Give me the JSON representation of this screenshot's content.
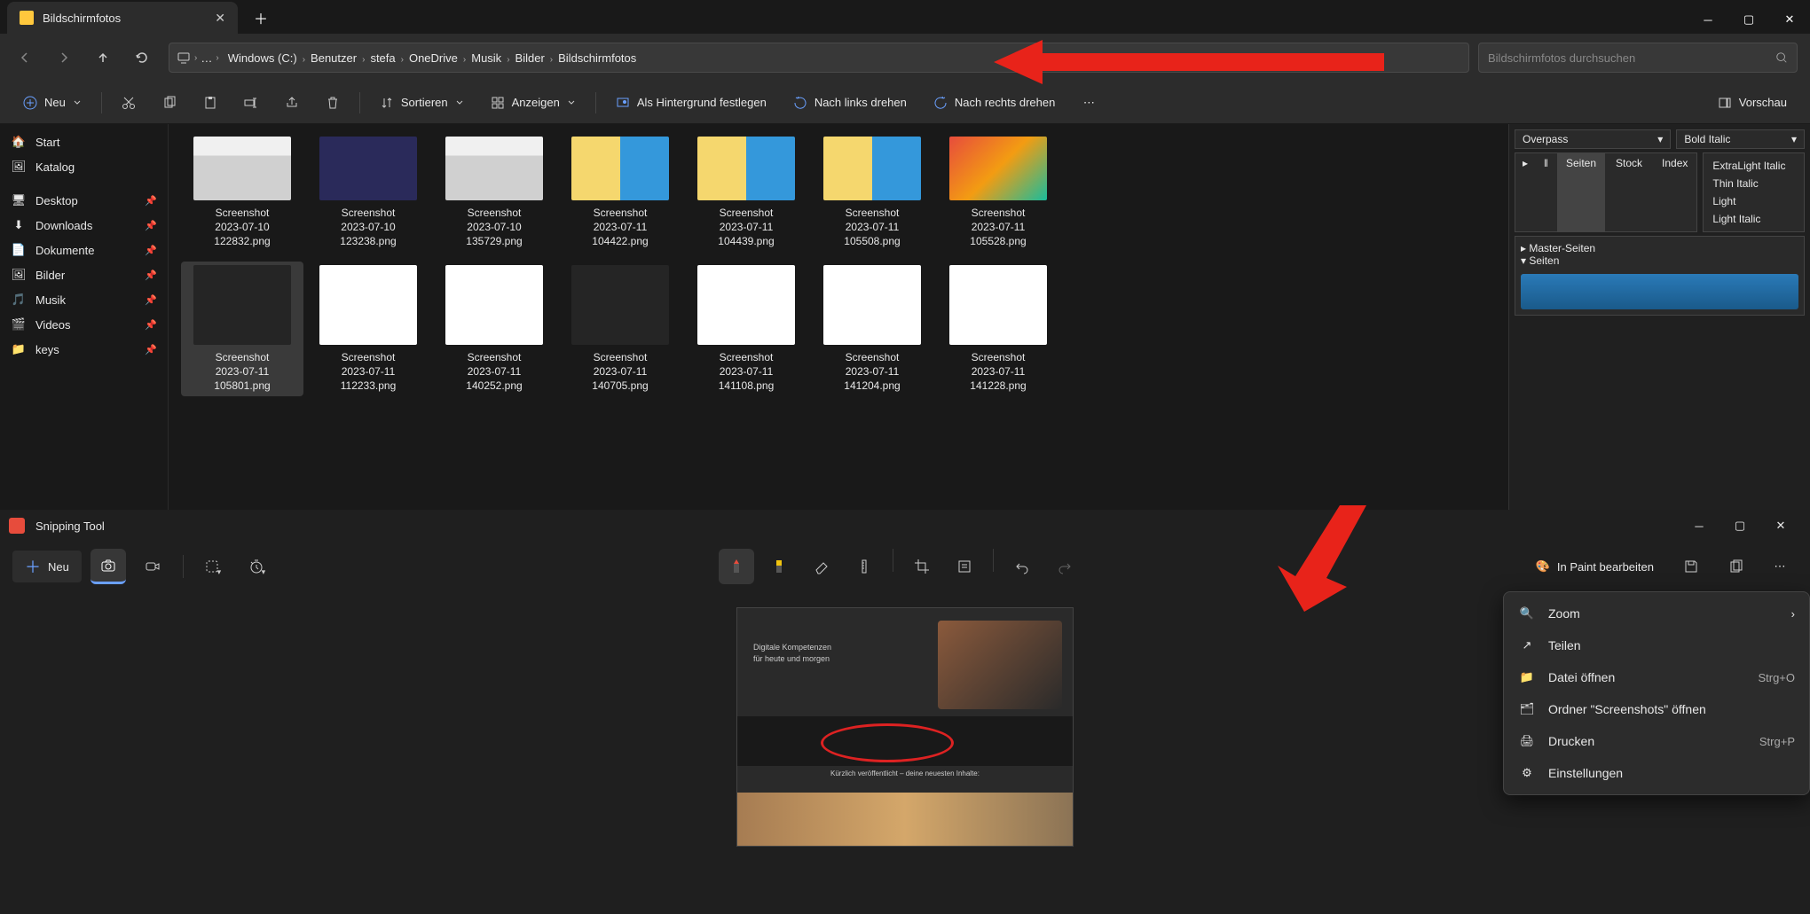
{
  "explorer": {
    "tab_title": "Bildschirmfotos",
    "breadcrumbs": [
      "Windows (C:)",
      "Benutzer",
      "stefa",
      "OneDrive",
      "Musik",
      "Bilder",
      "Bildschirmfotos"
    ],
    "addr_more": "…",
    "search_placeholder": "Bildschirmfotos durchsuchen",
    "commands": {
      "neu": "Neu",
      "sortieren": "Sortieren",
      "anzeigen": "Anzeigen",
      "hintergrund": "Als Hintergrund festlegen",
      "links": "Nach links drehen",
      "rechts": "Nach rechts drehen",
      "vorschau": "Vorschau"
    },
    "sidebar_top": [
      {
        "label": "Start",
        "icon": "home"
      },
      {
        "label": "Katalog",
        "icon": "gallery"
      }
    ],
    "sidebar_pinned": [
      {
        "label": "Desktop",
        "icon": "desktop"
      },
      {
        "label": "Downloads",
        "icon": "download"
      },
      {
        "label": "Dokumente",
        "icon": "document"
      },
      {
        "label": "Bilder",
        "icon": "image"
      },
      {
        "label": "Musik",
        "icon": "music"
      },
      {
        "label": "Videos",
        "icon": "video"
      },
      {
        "label": "keys",
        "icon": "folder"
      }
    ],
    "files": [
      {
        "name": "Screenshot 2023-07-10 122832.png",
        "thumb": "t1"
      },
      {
        "name": "Screenshot 2023-07-10 123238.png",
        "thumb": "t2"
      },
      {
        "name": "Screenshot 2023-07-10 135729.png",
        "thumb": "t1"
      },
      {
        "name": "Screenshot 2023-07-11 104422.png",
        "thumb": "t3"
      },
      {
        "name": "Screenshot 2023-07-11 104439.png",
        "thumb": "t3"
      },
      {
        "name": "Screenshot 2023-07-11 105508.png",
        "thumb": "t3"
      },
      {
        "name": "Screenshot 2023-07-11 105528.png",
        "thumb": "t4"
      },
      {
        "name": "Screenshot 2023-07-11 105801.png",
        "thumb": "t5",
        "selected": true
      },
      {
        "name": "Screenshot 2023-07-11 112233.png",
        "thumb": "t6"
      },
      {
        "name": "Screenshot 2023-07-11 140252.png",
        "thumb": "t6"
      },
      {
        "name": "Screenshot 2023-07-11 140705.png",
        "thumb": "t5"
      },
      {
        "name": "Screenshot 2023-07-11 141108.png",
        "thumb": "t6"
      },
      {
        "name": "Screenshot 2023-07-11 141204.png",
        "thumb": "t6"
      },
      {
        "name": "Screenshot 2023-07-11 141228.png",
        "thumb": "t6"
      }
    ],
    "panel": {
      "font": "Overpass",
      "weight": "Bold Italic",
      "tabs": [
        "Seiten",
        "Stock",
        "Index"
      ],
      "tree": [
        "Master-Seiten",
        "Seiten"
      ],
      "weights": [
        "ExtraLight Italic",
        "Thin Italic",
        "Light",
        "Light Italic"
      ]
    }
  },
  "snip": {
    "title": "Snipping Tool",
    "neu": "Neu",
    "paint": "In Paint bearbeiten",
    "canvas_text": "Digitale Kompetenzen\nfür heute und morgen",
    "canvas_footer": "Kürzlich veröffentlicht – deine neuesten Inhalte:",
    "menu": [
      {
        "label": "Zoom",
        "icon": "zoom",
        "chevron": true
      },
      {
        "label": "Teilen",
        "icon": "share"
      },
      {
        "label": "Datei öffnen",
        "icon": "folder",
        "shortcut": "Strg+O"
      },
      {
        "label": "Ordner \"Screenshots\" öffnen",
        "icon": "folder-open"
      },
      {
        "label": "Drucken",
        "icon": "print",
        "shortcut": "Strg+P"
      },
      {
        "label": "Einstellungen",
        "icon": "gear"
      }
    ]
  }
}
